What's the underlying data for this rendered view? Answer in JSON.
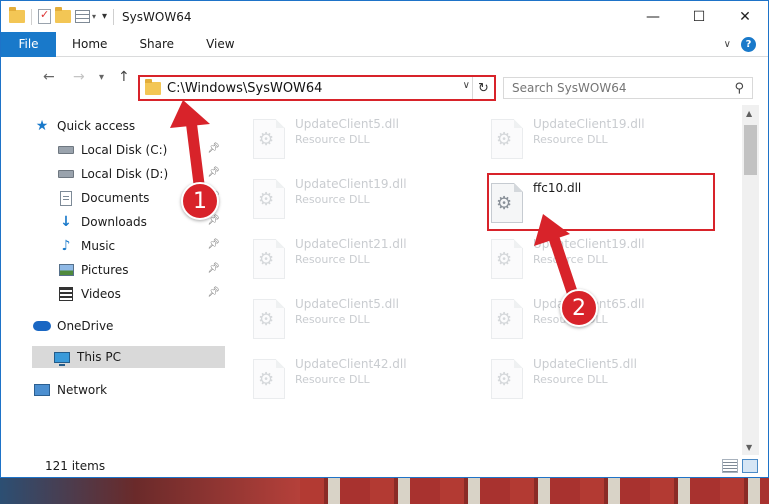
{
  "window": {
    "title": "SysWOW64",
    "minimize": "—",
    "maximize": "☐",
    "close": "✕"
  },
  "ribbon": {
    "tabs": [
      "File",
      "Home",
      "Share",
      "View"
    ]
  },
  "nav": {
    "back": "←",
    "forward": "→",
    "recent": "▾",
    "up": "↑",
    "address": "C:\\Windows\\SysWOW64",
    "search_placeholder": "Search SysWOW64"
  },
  "sidebar": {
    "items": [
      {
        "label": "Quick access",
        "icon": "star-icon"
      },
      {
        "label": "Local Disk (C:)",
        "icon": "disk-icon",
        "pinned": true
      },
      {
        "label": "Local Disk (D:)",
        "icon": "disk-icon",
        "pinned": true
      },
      {
        "label": "Documents",
        "icon": "document-icon",
        "pinned": true
      },
      {
        "label": "Downloads",
        "icon": "download-icon",
        "pinned": true
      },
      {
        "label": "Music",
        "icon": "music-icon",
        "pinned": true
      },
      {
        "label": "Pictures",
        "icon": "picture-icon",
        "pinned": true
      },
      {
        "label": "Videos",
        "icon": "video-icon",
        "pinned": true
      },
      {
        "label": "OneDrive",
        "icon": "cloud-icon"
      },
      {
        "label": "This PC",
        "icon": "pc-icon",
        "selected": true
      },
      {
        "label": "Network",
        "icon": "network-icon"
      }
    ]
  },
  "files": [
    {
      "name": "UpdateClient5.dll",
      "type": "Resource DLL",
      "dim": true
    },
    {
      "name": "UpdateClient19.dll",
      "type": "Resource DLL",
      "dim": true
    },
    {
      "name": "UpdateClient19.dll",
      "type": "Resource DLL",
      "dim": true
    },
    {
      "name": "ffc10.dll",
      "type": "",
      "dim": false,
      "highlight": true
    },
    {
      "name": "UpdateClient21.dll",
      "type": "Resource DLL",
      "dim": true
    },
    {
      "name": "UpdateClient19.dll",
      "type": "Resource DLL",
      "dim": true
    },
    {
      "name": "UpdateClient5.dll",
      "type": "Resource DLL",
      "dim": true
    },
    {
      "name": "UpdateClient65.dll",
      "type": "Resource DLL",
      "dim": true
    },
    {
      "name": "UpdateClient42.dll",
      "type": "Resource DLL",
      "dim": true
    },
    {
      "name": "UpdateClient5.dll",
      "type": "Resource DLL",
      "dim": true
    }
  ],
  "status": {
    "count": "121 items"
  },
  "annotations": {
    "step1": "1",
    "step2": "2",
    "color": "#d8232a"
  }
}
